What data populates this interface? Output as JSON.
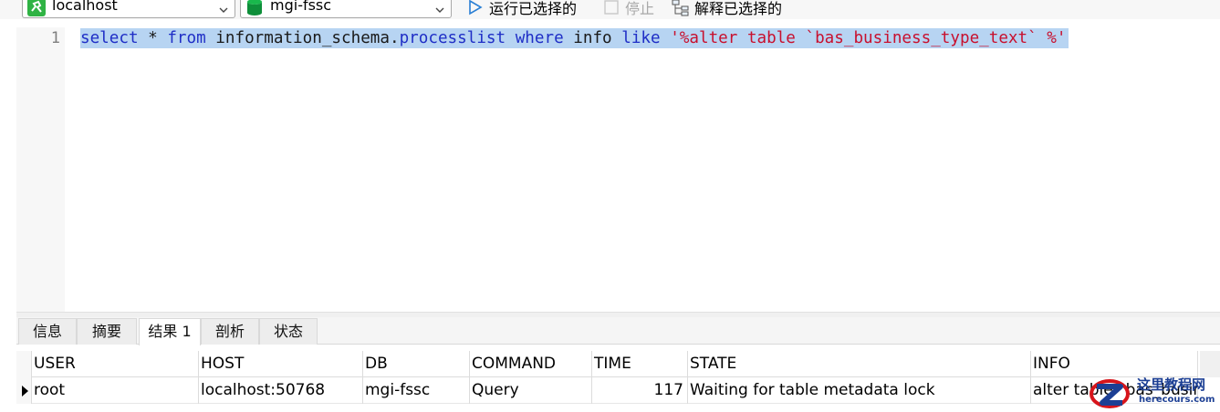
{
  "toolbar": {
    "connection": {
      "value": "localhost",
      "icon": "connection-icon"
    },
    "database": {
      "value": "mgi-fssc",
      "icon": "database-icon"
    },
    "run_selected_label": "运行已选择的",
    "stop_label": "停止",
    "explain_selected_label": "解释已选择的"
  },
  "editor": {
    "line_number": "1",
    "tokens": {
      "t1": "select",
      "t2": " * ",
      "t3": "from",
      "t4": " information_schema.",
      "t5": "processlist",
      "t6": " ",
      "t7": "where",
      "t8": " info ",
      "t9": "like",
      "t10": " ",
      "t11": "'%alter table `bas_business_type_text` %'"
    }
  },
  "result_tabs": [
    {
      "label": "信息"
    },
    {
      "label": "摘要"
    },
    {
      "label": "结果 1",
      "active": true
    },
    {
      "label": "剖析"
    },
    {
      "label": "状态"
    }
  ],
  "grid": {
    "columns": [
      "USER",
      "HOST",
      "DB",
      "COMMAND",
      "TIME",
      "STATE",
      "INFO"
    ],
    "rows": [
      [
        "root",
        "localhost:50768",
        "mgi-fssc",
        "Query",
        "117",
        "Waiting for table metadata lock",
        "alter table `bas_business_type_text`"
      ]
    ]
  },
  "watermark": {
    "title": "这里教程网",
    "url": "herecours.com"
  },
  "colors": {
    "keyword": "#1f2ec6",
    "string": "#c8102e",
    "selection": "#b7d4f2",
    "connection_green": "#2fb344",
    "database_green": "#0e8f3a"
  }
}
